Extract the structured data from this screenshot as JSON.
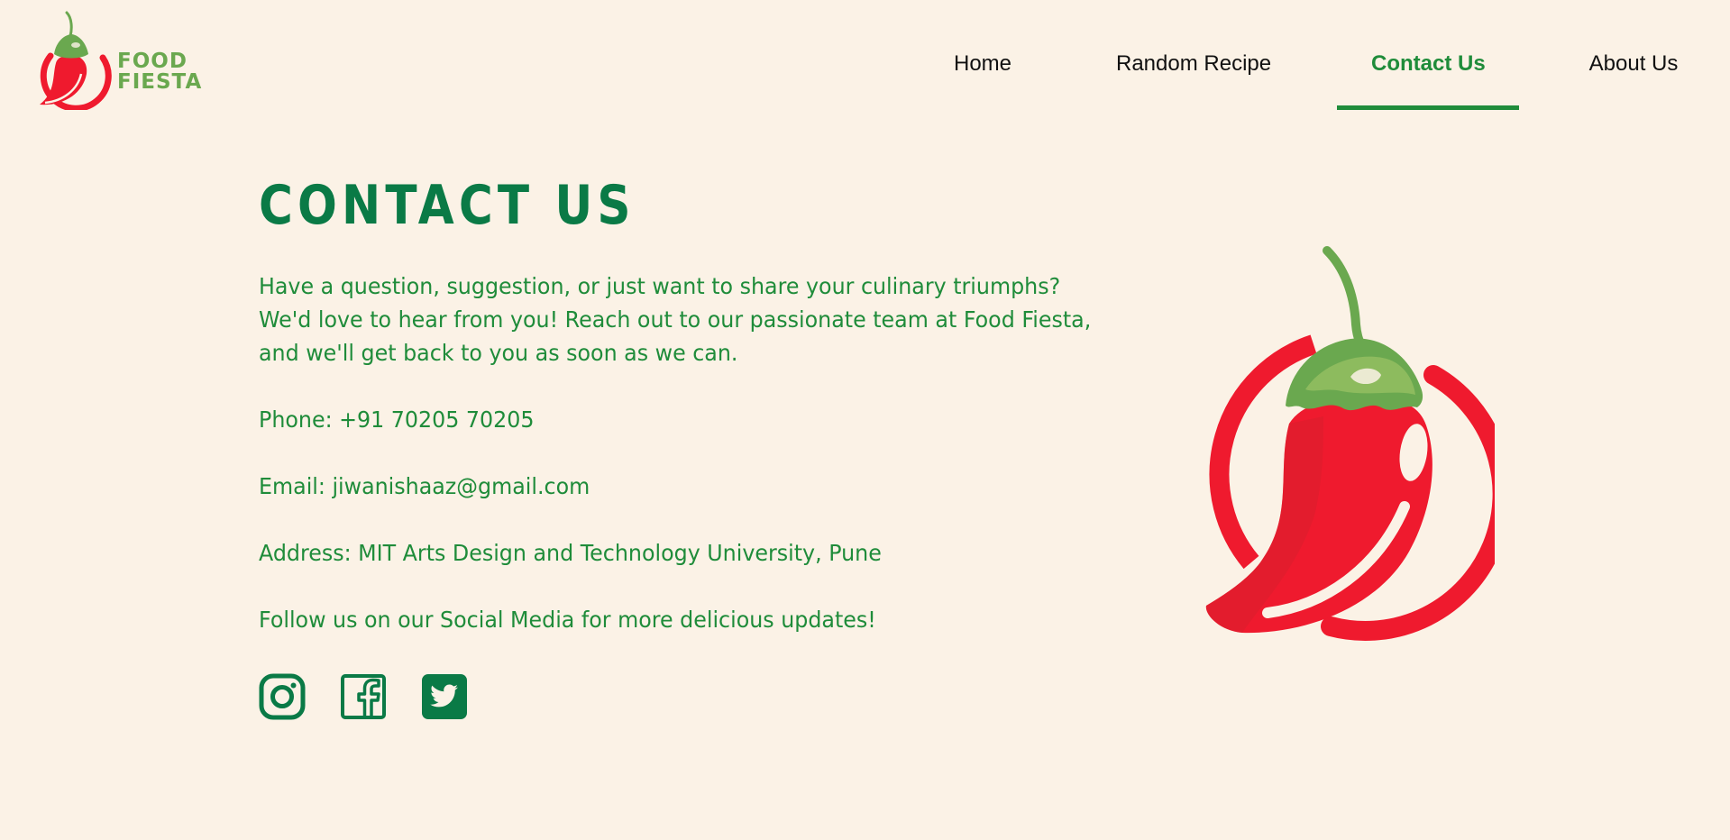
{
  "colors": {
    "background": "#fbf2e6",
    "brand_green": "#1f8c3a",
    "heading_green": "#0a7a46",
    "pepper_red": "#ef1a2e",
    "logo_green": "#6aa84f"
  },
  "header": {
    "logo": {
      "line1": "FOOD",
      "line2": "FIESTA"
    },
    "nav": [
      {
        "label": "Home",
        "active": false
      },
      {
        "label": "Random Recipe",
        "active": false
      },
      {
        "label": "Contact Us",
        "active": true
      },
      {
        "label": "About Us",
        "active": false
      }
    ]
  },
  "main": {
    "heading": "CONTACT US",
    "intro_lines": [
      "Have a question, suggestion, or just want to share your culinary triumphs?",
      "We'd love to hear from you! Reach out to our passionate team at Food Fiesta,",
      "and we'll get back to you as soon as we can."
    ],
    "phone": "Phone: +91 70205 70205",
    "email": "Email: jiwanishaaz@gmail.com",
    "address": "Address: MIT Arts Design and Technology University, Pune",
    "follow": "Follow us on our Social Media for more delicious updates!",
    "social": [
      {
        "icon": "instagram-icon"
      },
      {
        "icon": "facebook-icon"
      },
      {
        "icon": "twitter-icon"
      }
    ]
  }
}
